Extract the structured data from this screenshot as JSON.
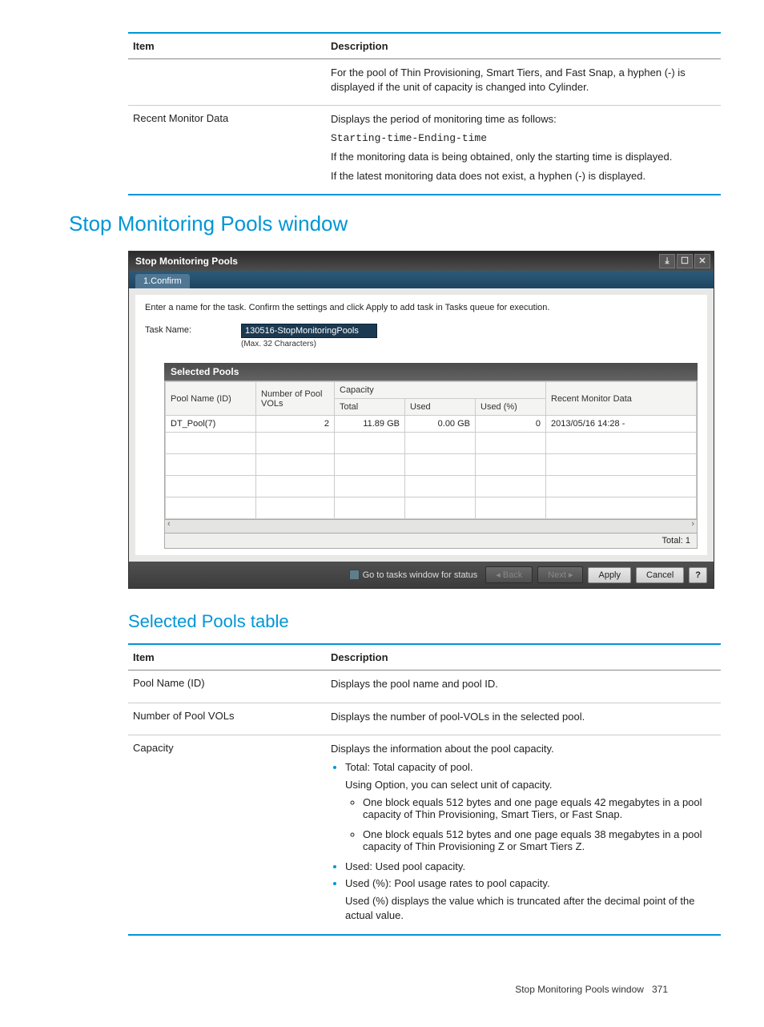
{
  "top_table": {
    "headers": [
      "Item",
      "Description"
    ],
    "row0_desc": "For the pool of Thin Provisioning, Smart Tiers, and Fast Snap, a hyphen (-) is displayed if the unit of capacity is changed into Cylinder.",
    "row1_item": "Recent Monitor Data",
    "row1_p1": "Displays the period of monitoring time as follows:",
    "row1_code": "Starting-time-Ending-time",
    "row1_p2": "If the monitoring data is being obtained, only the starting time is displayed.",
    "row1_p3": "If the latest monitoring data does not exist, a hyphen (-) is displayed."
  },
  "section_heading": "Stop Monitoring Pools window",
  "dialog": {
    "title": "Stop Monitoring Pools",
    "tab": "1.Confirm",
    "instruction": "Enter a name for the task. Confirm the settings and click Apply to add task in Tasks queue for execution.",
    "task_label": "Task Name:",
    "task_value": "130516-StopMonitoringPools",
    "task_hint": "(Max. 32 Characters)",
    "selected_header": "Selected Pools",
    "grid": {
      "h_pool": "Pool Name (ID)",
      "h_num": "Number of Pool VOLs",
      "h_cap": "Capacity",
      "h_total": "Total",
      "h_used": "Used",
      "h_usedpct": "Used (%)",
      "h_recent": "Recent Monitor Data",
      "row": {
        "pool": "DT_Pool(7)",
        "num": "2",
        "total": "11.89 GB",
        "used": "0.00 GB",
        "usedpct": "0",
        "recent": "2013/05/16 14:28 -"
      }
    },
    "total_label": "Total:  1",
    "footer": {
      "chk": "Go to tasks window for status",
      "back": "Back",
      "next": "Next",
      "apply": "Apply",
      "cancel": "Cancel",
      "help": "?"
    }
  },
  "sub_heading": "Selected Pools table",
  "table2": {
    "headers": [
      "Item",
      "Description"
    ],
    "r1_item": "Pool Name (ID)",
    "r1_desc": "Displays the pool name and pool ID.",
    "r2_item": "Number of Pool VOLs",
    "r2_desc": "Displays the number of pool-VOLs in the selected pool.",
    "r3_item": "Capacity",
    "r3_intro": "Displays the information about the pool capacity.",
    "r3_b1": "Total: Total capacity of pool.",
    "r3_b1a": "Using Option, you can select unit of capacity.",
    "r3_s1": "One block equals 512 bytes and one page equals 42 megabytes in a pool capacity of Thin Provisioning, Smart Tiers, or Fast Snap.",
    "r3_s2": "One block equals 512 bytes and one page equals 38 megabytes in a pool capacity of Thin Provisioning Z or Smart Tiers Z.",
    "r3_b2": "Used: Used pool capacity.",
    "r3_b3": "Used (%): Pool usage rates to pool capacity.",
    "r3_b3a": "Used (%) displays the value which is truncated after the decimal point of the actual value."
  },
  "page_footer": {
    "text": "Stop Monitoring Pools window",
    "num": "371"
  }
}
